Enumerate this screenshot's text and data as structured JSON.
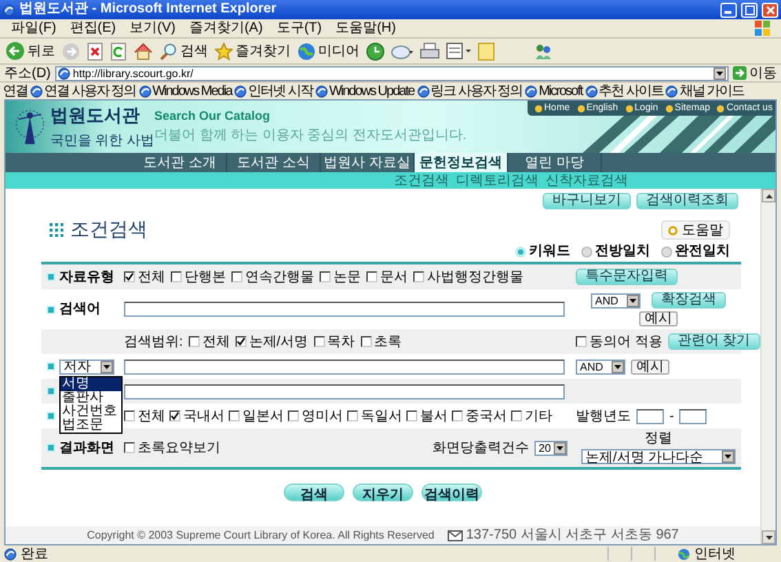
{
  "window": {
    "title": "법원도서관 - Microsoft Internet Explorer"
  },
  "menu": [
    "파일(F)",
    "편집(E)",
    "보기(V)",
    "즐겨찾기(A)",
    "도구(T)",
    "도움말(H)"
  ],
  "toolbar": {
    "back": "뒤로",
    "search": "검색",
    "favorites": "즐겨찾기",
    "media": "미디어"
  },
  "address_bar": {
    "label": "주소(D)",
    "url": "http://library.scourt.go.kr/",
    "go": "이동"
  },
  "links_bar": {
    "label": "연결",
    "links": [
      "연결 사용자 정의",
      "Windows Media",
      "인터넷 시작",
      "Windows Update",
      "링크 사용자 정의",
      "Microsoft",
      "추천 사이트",
      "채널 가이드"
    ]
  },
  "site_header": {
    "logo_title": "법원도서관",
    "logo_subtitle": "국민을 위한 사법",
    "catalog_title": "Search Our Catalog",
    "tagline": "더불어 함께 하는 이용자 중심의 전자도서관입니다.",
    "top_links": [
      "Home",
      "English",
      "Login",
      "Sitemap",
      "Contact us"
    ]
  },
  "nav": {
    "tabs": [
      {
        "label": "도서관 소개",
        "selected": false
      },
      {
        "label": "도서관 소식",
        "selected": false
      },
      {
        "label": "법원사 자료실",
        "selected": false
      },
      {
        "label": "문헌정보검색",
        "selected": true
      },
      {
        "label": "열린 마당",
        "selected": false
      }
    ],
    "sub_links": [
      "조건검색",
      "디렉토리검색",
      "신착자료검색"
    ]
  },
  "top_buttons": [
    "바구니보기",
    "검색이력조회"
  ],
  "page_title": "조건검색",
  "help_button": "도움말",
  "match_modes": [
    {
      "label": "키워드",
      "selected": true
    },
    {
      "label": "전방일치",
      "selected": false
    },
    {
      "label": "완전일치",
      "selected": false
    }
  ],
  "form": {
    "material_type": {
      "label": "자료유형",
      "options": [
        {
          "label": "전체",
          "checked": true
        },
        {
          "label": "단행본",
          "checked": false
        },
        {
          "label": "연속간행물",
          "checked": false
        },
        {
          "label": "논문",
          "checked": false
        },
        {
          "label": "문서",
          "checked": false
        },
        {
          "label": "사법행정간행물",
          "checked": false
        }
      ],
      "button": "특수문자입력"
    },
    "search_term": {
      "label": "검색어",
      "operator": "AND",
      "expand_button": "확장검색",
      "example_button": "예시"
    },
    "search_scope": {
      "label": "검색범위:",
      "options": [
        {
          "label": "전체",
          "checked": false
        },
        {
          "label": "논제/서명",
          "checked": true
        },
        {
          "label": "목차",
          "checked": false
        },
        {
          "label": "초록",
          "checked": false
        }
      ],
      "synonym": {
        "label": "동의어 적용",
        "checked": false
      },
      "related_button": "관련어 찾기"
    },
    "field_row": {
      "field": "저자",
      "operator": "AND",
      "example_button": "예시",
      "dropdown": {
        "options": [
          {
            "label": "서명",
            "selected": true
          },
          {
            "label": "출판사",
            "selected": false
          },
          {
            "label": "사건번호",
            "selected": false
          },
          {
            "label": "법조문",
            "selected": false
          }
        ]
      }
    },
    "language": {
      "options": [
        {
          "label": "전체",
          "checked": false
        },
        {
          "label": "국내서",
          "checked": true
        },
        {
          "label": "일본서",
          "checked": false
        },
        {
          "label": "영미서",
          "checked": false
        },
        {
          "label": "독일서",
          "checked": false
        },
        {
          "label": "불서",
          "checked": false
        },
        {
          "label": "중국서",
          "checked": false
        },
        {
          "label": "기타",
          "checked": false
        }
      ],
      "year_label": "발행년도",
      "year_separator": "-"
    },
    "results": {
      "label": "결과화면",
      "summary": {
        "label": "초록요약보기",
        "checked": false
      },
      "per_page_label": "화면당출력건수",
      "per_page": "20",
      "sort_label": "정렬",
      "sort": "논제/서명 가나다순"
    }
  },
  "actions": [
    "검색",
    "지우기",
    "검색이력"
  ],
  "footer": {
    "copyright": "Copyright © 2003 Supreme Court Library of Korea. All Rights Reserved",
    "address": "137-750 서울시 서초구 서초동 967"
  },
  "status_bar": {
    "status": "완료",
    "zone": "인터넷"
  }
}
